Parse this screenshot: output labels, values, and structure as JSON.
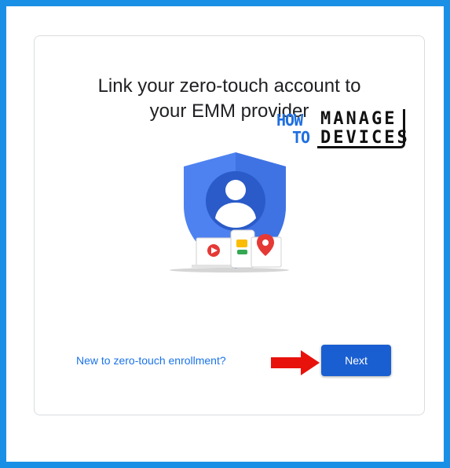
{
  "card": {
    "title_line1": "Link your zero-touch account to",
    "title_line2": "your EMM provider"
  },
  "illustration": {
    "icon": "shield-account-devices-illustration",
    "colors": {
      "shield": "#4e82f0",
      "avatar_circle": "#2a5bc9",
      "youtube": "#e53935",
      "maps": "#e53935",
      "messages": "#fbbc04"
    }
  },
  "watermark": {
    "how": "HOW",
    "to": "TO",
    "manage": "MANAGE",
    "devices": "DEVICES"
  },
  "footer": {
    "link_label": "New to zero-touch enrollment?",
    "next_label": "Next",
    "arrow_icon": "red-arrow-right-icon"
  },
  "colors": {
    "frame_border": "#1a8fe6",
    "link": "#1a73e8",
    "button": "#1a5fd1",
    "arrow": "#e8120c"
  }
}
